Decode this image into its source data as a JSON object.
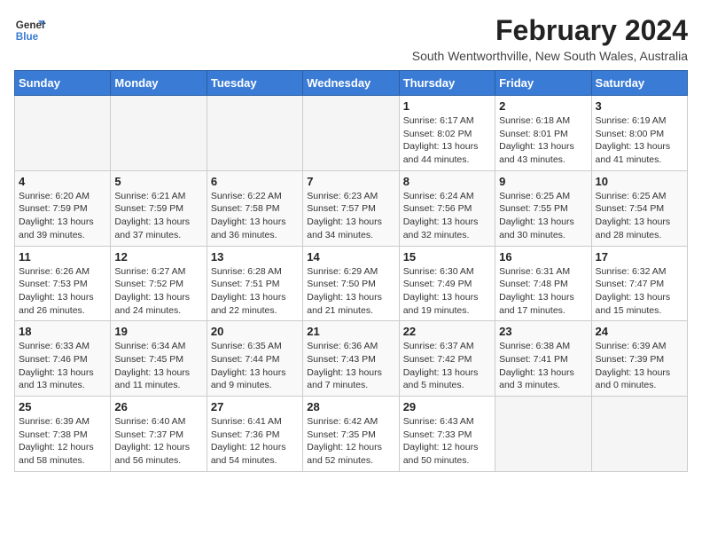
{
  "logo": {
    "line1": "General",
    "line2": "Blue"
  },
  "title": "February 2024",
  "subtitle": "South Wentworthville, New South Wales, Australia",
  "days_header": [
    "Sunday",
    "Monday",
    "Tuesday",
    "Wednesday",
    "Thursday",
    "Friday",
    "Saturday"
  ],
  "weeks": [
    [
      {
        "day": "",
        "detail": ""
      },
      {
        "day": "",
        "detail": ""
      },
      {
        "day": "",
        "detail": ""
      },
      {
        "day": "",
        "detail": ""
      },
      {
        "day": "1",
        "detail": "Sunrise: 6:17 AM\nSunset: 8:02 PM\nDaylight: 13 hours\nand 44 minutes."
      },
      {
        "day": "2",
        "detail": "Sunrise: 6:18 AM\nSunset: 8:01 PM\nDaylight: 13 hours\nand 43 minutes."
      },
      {
        "day": "3",
        "detail": "Sunrise: 6:19 AM\nSunset: 8:00 PM\nDaylight: 13 hours\nand 41 minutes."
      }
    ],
    [
      {
        "day": "4",
        "detail": "Sunrise: 6:20 AM\nSunset: 7:59 PM\nDaylight: 13 hours\nand 39 minutes."
      },
      {
        "day": "5",
        "detail": "Sunrise: 6:21 AM\nSunset: 7:59 PM\nDaylight: 13 hours\nand 37 minutes."
      },
      {
        "day": "6",
        "detail": "Sunrise: 6:22 AM\nSunset: 7:58 PM\nDaylight: 13 hours\nand 36 minutes."
      },
      {
        "day": "7",
        "detail": "Sunrise: 6:23 AM\nSunset: 7:57 PM\nDaylight: 13 hours\nand 34 minutes."
      },
      {
        "day": "8",
        "detail": "Sunrise: 6:24 AM\nSunset: 7:56 PM\nDaylight: 13 hours\nand 32 minutes."
      },
      {
        "day": "9",
        "detail": "Sunrise: 6:25 AM\nSunset: 7:55 PM\nDaylight: 13 hours\nand 30 minutes."
      },
      {
        "day": "10",
        "detail": "Sunrise: 6:25 AM\nSunset: 7:54 PM\nDaylight: 13 hours\nand 28 minutes."
      }
    ],
    [
      {
        "day": "11",
        "detail": "Sunrise: 6:26 AM\nSunset: 7:53 PM\nDaylight: 13 hours\nand 26 minutes."
      },
      {
        "day": "12",
        "detail": "Sunrise: 6:27 AM\nSunset: 7:52 PM\nDaylight: 13 hours\nand 24 minutes."
      },
      {
        "day": "13",
        "detail": "Sunrise: 6:28 AM\nSunset: 7:51 PM\nDaylight: 13 hours\nand 22 minutes."
      },
      {
        "day": "14",
        "detail": "Sunrise: 6:29 AM\nSunset: 7:50 PM\nDaylight: 13 hours\nand 21 minutes."
      },
      {
        "day": "15",
        "detail": "Sunrise: 6:30 AM\nSunset: 7:49 PM\nDaylight: 13 hours\nand 19 minutes."
      },
      {
        "day": "16",
        "detail": "Sunrise: 6:31 AM\nSunset: 7:48 PM\nDaylight: 13 hours\nand 17 minutes."
      },
      {
        "day": "17",
        "detail": "Sunrise: 6:32 AM\nSunset: 7:47 PM\nDaylight: 13 hours\nand 15 minutes."
      }
    ],
    [
      {
        "day": "18",
        "detail": "Sunrise: 6:33 AM\nSunset: 7:46 PM\nDaylight: 13 hours\nand 13 minutes."
      },
      {
        "day": "19",
        "detail": "Sunrise: 6:34 AM\nSunset: 7:45 PM\nDaylight: 13 hours\nand 11 minutes."
      },
      {
        "day": "20",
        "detail": "Sunrise: 6:35 AM\nSunset: 7:44 PM\nDaylight: 13 hours\nand 9 minutes."
      },
      {
        "day": "21",
        "detail": "Sunrise: 6:36 AM\nSunset: 7:43 PM\nDaylight: 13 hours\nand 7 minutes."
      },
      {
        "day": "22",
        "detail": "Sunrise: 6:37 AM\nSunset: 7:42 PM\nDaylight: 13 hours\nand 5 minutes."
      },
      {
        "day": "23",
        "detail": "Sunrise: 6:38 AM\nSunset: 7:41 PM\nDaylight: 13 hours\nand 3 minutes."
      },
      {
        "day": "24",
        "detail": "Sunrise: 6:39 AM\nSunset: 7:39 PM\nDaylight: 13 hours\nand 0 minutes."
      }
    ],
    [
      {
        "day": "25",
        "detail": "Sunrise: 6:39 AM\nSunset: 7:38 PM\nDaylight: 12 hours\nand 58 minutes."
      },
      {
        "day": "26",
        "detail": "Sunrise: 6:40 AM\nSunset: 7:37 PM\nDaylight: 12 hours\nand 56 minutes."
      },
      {
        "day": "27",
        "detail": "Sunrise: 6:41 AM\nSunset: 7:36 PM\nDaylight: 12 hours\nand 54 minutes."
      },
      {
        "day": "28",
        "detail": "Sunrise: 6:42 AM\nSunset: 7:35 PM\nDaylight: 12 hours\nand 52 minutes."
      },
      {
        "day": "29",
        "detail": "Sunrise: 6:43 AM\nSunset: 7:33 PM\nDaylight: 12 hours\nand 50 minutes."
      },
      {
        "day": "",
        "detail": ""
      },
      {
        "day": "",
        "detail": ""
      }
    ]
  ]
}
